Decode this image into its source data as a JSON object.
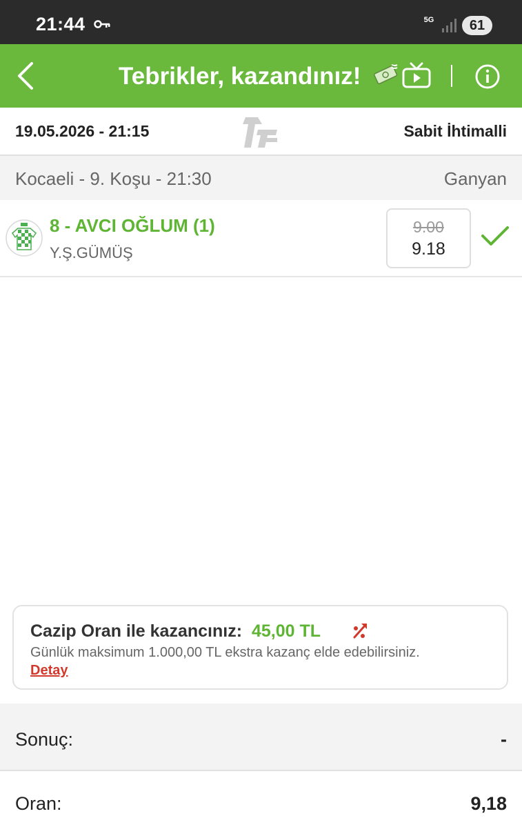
{
  "status_bar": {
    "time": "21:44",
    "network": "5G",
    "battery": "61"
  },
  "header": {
    "title": "Tebrikler, kazandınız!",
    "icons": [
      "back-arrow-icon",
      "money-icon",
      "tv-icon",
      "info-icon"
    ]
  },
  "ticket": {
    "date": "19.05.2026 - 21:15",
    "type": "Sabit İhtimalli"
  },
  "race": {
    "title": "Kocaeli - 9. Koşu - 21:30",
    "bet_type": "Ganyan"
  },
  "selection": {
    "horse": "8 - AVCI OĞLUM (1)",
    "jockey": "Y.Ş.GÜMÜŞ",
    "old_odds": "9.00",
    "new_odds": "9.18",
    "won": true
  },
  "promo": {
    "title": "Cazip Oran ile kazancınız:",
    "amount": "45,00 TL",
    "description": "Günlük maksimum 1.000,00 TL ekstra kazanç elde edebilirsiniz.",
    "link": "Detay"
  },
  "summary": {
    "result_label": "Sonuç:",
    "result_value": "-",
    "odds_label": "Oran:",
    "odds_value": "9,18"
  },
  "colors": {
    "brand_green": "#6ab93c",
    "accent_green": "#5eb534",
    "link_red": "#d0392b"
  }
}
